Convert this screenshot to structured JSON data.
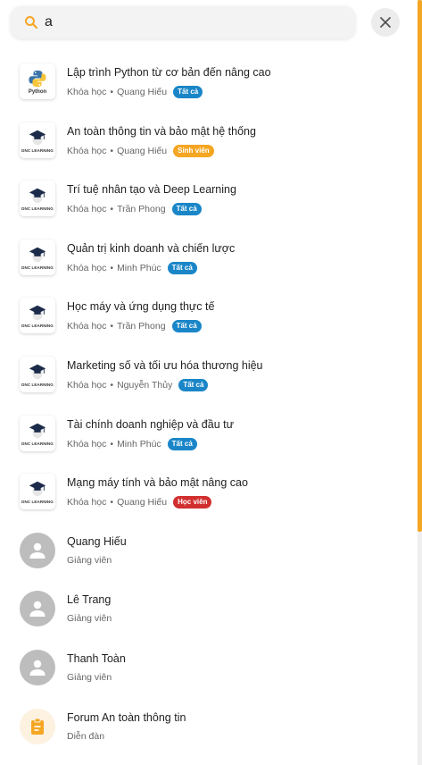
{
  "search": {
    "value": "a"
  },
  "colors": {
    "accent": "#f5a623",
    "badge_all": "#1a86c8",
    "badge_student": "#f5a623",
    "badge_learner": "#d12f2f"
  },
  "courses": [
    {
      "title": "Lập trình Python từ cơ bản đến nâng cao",
      "type": "Khóa học",
      "author": "Quang Hiếu",
      "badge": "Tất cả",
      "badge_kind": "all",
      "logo": "python",
      "logo_text": "Python"
    },
    {
      "title": "An toàn thông tin và bảo mật hệ thống",
      "type": "Khóa học",
      "author": "Quang Hiếu",
      "badge": "Sinh viên",
      "badge_kind": "sv",
      "logo": "dnc",
      "logo_text": "DNC LEARNING"
    },
    {
      "title": "Trí tuệ nhân tạo và Deep Learning",
      "type": "Khóa học",
      "author": "Trần Phong",
      "badge": "Tất cả",
      "badge_kind": "all",
      "logo": "dnc",
      "logo_text": "DNC LEARNING"
    },
    {
      "title": "Quản trị kinh doanh và chiến lược",
      "type": "Khóa học",
      "author": "Minh Phúc",
      "badge": "Tất cả",
      "badge_kind": "all",
      "logo": "dnc",
      "logo_text": "DNC LEARNING"
    },
    {
      "title": "Học máy và ứng dụng thực tế",
      "type": "Khóa học",
      "author": "Trần Phong",
      "badge": "Tất cả",
      "badge_kind": "all",
      "logo": "dnc",
      "logo_text": "DNC LEARNING"
    },
    {
      "title": "Marketing số và tối ưu hóa thương hiệu",
      "type": "Khóa học",
      "author": "Nguyễn Thủy",
      "badge": "Tất cả",
      "badge_kind": "all",
      "logo": "dnc",
      "logo_text": "DNC LEARNING"
    },
    {
      "title": "Tài chính doanh nghiệp và đầu tư",
      "type": "Khóa học",
      "author": "Minh Phúc",
      "badge": "Tất cả",
      "badge_kind": "all",
      "logo": "dnc",
      "logo_text": "DNC LEARNING"
    },
    {
      "title": "Mạng máy tính và bảo mật nâng cao",
      "type": "Khóa học",
      "author": "Quang Hiếu",
      "badge": "Học viên",
      "badge_kind": "hv",
      "logo": "dnc",
      "logo_text": "DNC LEARNING"
    }
  ],
  "separator": "•",
  "instructors": [
    {
      "name": "Quang Hiếu",
      "role": "Giảng viên"
    },
    {
      "name": "Lê Trang",
      "role": "Giảng viên"
    },
    {
      "name": "Thanh Toàn",
      "role": "Giảng viên"
    }
  ],
  "forums": [
    {
      "title": "Forum An toàn thông tin",
      "type": "Diễn đàn"
    }
  ]
}
